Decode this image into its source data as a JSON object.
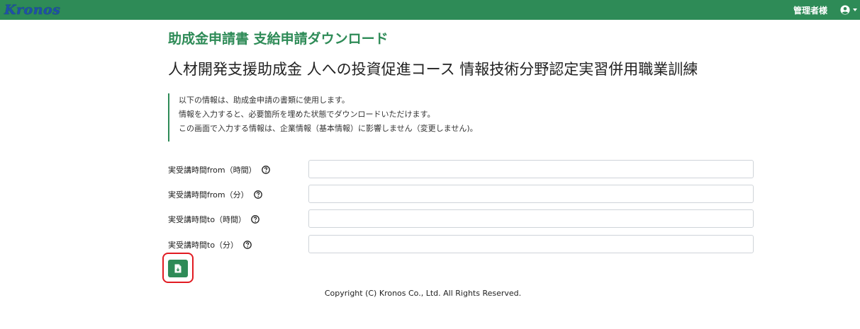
{
  "navbar": {
    "logo_text": "Kronos",
    "user_label": "管理者様",
    "colors": {
      "bar": "#2e8b57",
      "logo": "#1f4fa8"
    }
  },
  "page": {
    "title": "助成金申請書 支給申請ダウンロード",
    "subtitle": "人材開発支援助成金 人への投資促進コース 情報技術分野認定実習併用職業訓練"
  },
  "info": {
    "lines": [
      "以下の情報は、助成金申請の書類に使用します。",
      "情報を入力すると、必要箇所を埋めた状態でダウンロードいただけます。",
      "この画面で入力する情報は、企業情報（基本情報）に影響しません（変更しません)。"
    ]
  },
  "form": {
    "fields": [
      {
        "label": "実受講時間from（時間）",
        "value": ""
      },
      {
        "label": "実受講時間from（分）",
        "value": ""
      },
      {
        "label": "実受講時間to（時間）",
        "value": ""
      },
      {
        "label": "実受講時間to（分）",
        "value": ""
      }
    ]
  },
  "actions": {
    "download_icon": "file-download-icon",
    "highlight_color": "#e11b22"
  },
  "footer": {
    "copyright": "Copyright (C) Kronos Co., Ltd. All Rights Reserved."
  }
}
